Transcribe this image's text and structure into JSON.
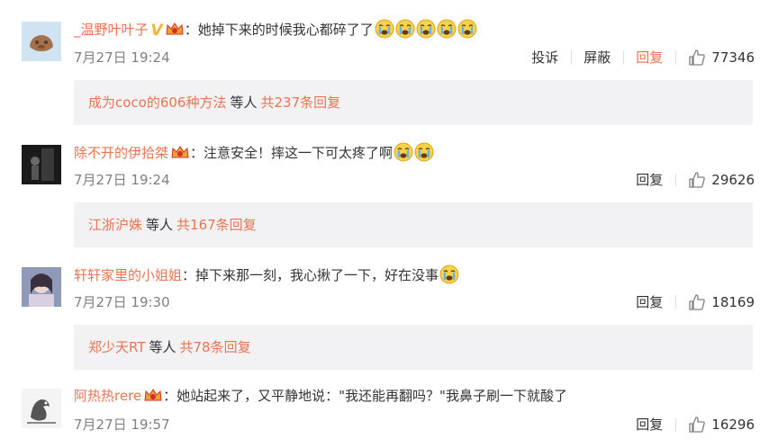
{
  "comments": [
    {
      "username": "_温野叶叶子",
      "colon": "：",
      "text": "她掉下来的时候我心都碎了了",
      "time": "7月27日 19:24",
      "actions": [
        "投诉",
        "屏蔽",
        "回复"
      ],
      "likes": "77346",
      "verified": "V",
      "emoji": [
        "crying-face-icon",
        "crying-face-icon",
        "crying-face-icon",
        "crying-face-icon",
        "crying-face-icon"
      ],
      "sub": {
        "who": "成为coco的606种方法",
        "etc": "等人",
        "total": "共237条回复"
      }
    },
    {
      "username": "除不开的伊拾桀",
      "colon": "：",
      "text": "注意安全！摔这一下可太疼了啊",
      "time": "7月27日 19:24",
      "actions": [
        "回复"
      ],
      "likes": "29626",
      "emoji": [
        "crying-face-icon",
        "crying-face-icon"
      ],
      "sub": {
        "who": "江浙沪姝",
        "etc": "等人",
        "total": "共167条回复"
      }
    },
    {
      "username": "轩轩家里的小姐姐",
      "colon": "：",
      "text": "掉下来那一刻，我心揪了一下，好在没事",
      "time": "7月27日 19:30",
      "actions": [
        "回复"
      ],
      "likes": "18169",
      "emoji": [
        "crying-face-icon"
      ],
      "sub": {
        "who": "郑少天RT",
        "etc": "等人",
        "total": "共78条回复"
      }
    },
    {
      "username": "阿热热rere",
      "colon": "：",
      "text": "她站起来了，又平静地说：\"我还能再翻吗？\"我鼻子刷一下就酸了",
      "time": "7月27日 19:57",
      "actions": [
        "回复"
      ],
      "likes": "16296",
      "emoji": []
    }
  ],
  "colors": {
    "accent": "#eb7350",
    "time": "#808080",
    "subBg": "#f2f2f5",
    "text": "#333333"
  }
}
